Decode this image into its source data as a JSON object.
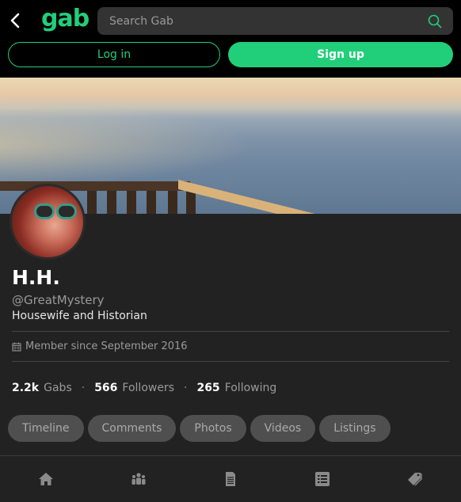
{
  "header": {
    "logo": "gab",
    "search_placeholder": "Search Gab",
    "login_label": "Log in",
    "signup_label": "Sign up"
  },
  "profile": {
    "display_name": "H.H.",
    "handle": "@GreatMystery",
    "bio": "Housewife and Historian",
    "member_since": "Member since September 2016",
    "stats": [
      {
        "value": "2.2k",
        "label": "Gabs"
      },
      {
        "value": "566",
        "label": "Followers"
      },
      {
        "value": "265",
        "label": "Following"
      }
    ]
  },
  "tabs": [
    "Timeline",
    "Comments",
    "Photos",
    "Videos",
    "Listings"
  ],
  "bottom_nav": [
    {
      "icon": "home-icon"
    },
    {
      "icon": "groups-icon"
    },
    {
      "icon": "news-icon"
    },
    {
      "icon": "list-icon"
    },
    {
      "icon": "tags-icon"
    }
  ],
  "colors": {
    "accent": "#21cf7a",
    "background": "#222222",
    "topbar": "#000000",
    "tab_bg": "#4f4f4f",
    "muted_text": "#9a9a9a"
  }
}
